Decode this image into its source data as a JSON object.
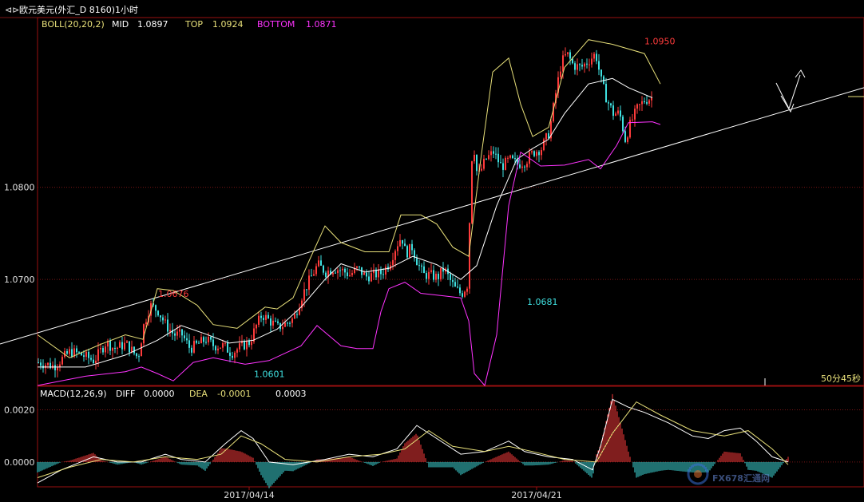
{
  "window": {
    "title": "欧元美元(外汇_D 8160)1小时",
    "countdown": "50分45秒",
    "watermark": "FX678汇通网"
  },
  "colors": {
    "up": "#ff3b3b",
    "down": "#3fe0e0",
    "boll_mid": "#ffffff",
    "boll_top": "#e8e07a",
    "boll_bottom": "#ff33ff",
    "grid": "#7a1515",
    "trendline": "#ffffff"
  },
  "boll": {
    "label": "BOLL(20,20,2)",
    "mid_label": "MID",
    "mid": "1.0897",
    "top_label": "TOP",
    "top": "1.0924",
    "bottom_label": "BOTTOM",
    "bottom": "1.0871"
  },
  "macd": {
    "label": "MACD(12,26,9)",
    "diff_label": "DIFF",
    "diff": "0.0000",
    "dea_label": "DEA",
    "dea": "-0.0001",
    "macd": "0.0003"
  },
  "chart_data": [
    {
      "type": "candlestick",
      "title": "",
      "y_ticks": [
        "1.0800",
        "1.0700"
      ],
      "ylim": [
        1.0585,
        1.0984
      ],
      "x_ticks": [
        "2017/04/14",
        "2017/04/21"
      ],
      "annotations": [
        {
          "text": "1.0676",
          "value": 1.0676
        },
        {
          "text": "1.0601",
          "value": 1.0601
        },
        {
          "text": "1.0681",
          "value": 1.0681
        },
        {
          "text": "1.0950",
          "value": 1.095
        }
      ],
      "close_path": [
        [
          0,
          1.061
        ],
        [
          20,
          1.0606
        ],
        [
          40,
          1.0622
        ],
        [
          55,
          1.0618
        ],
        [
          70,
          1.0612
        ],
        [
          85,
          1.0632
        ],
        [
          95,
          1.0625
        ],
        [
          110,
          1.063
        ],
        [
          125,
          1.0615
        ],
        [
          132,
          1.065
        ],
        [
          140,
          1.0672
        ],
        [
          150,
          1.0666
        ],
        [
          160,
          1.065
        ],
        [
          170,
          1.064
        ],
        [
          180,
          1.064
        ],
        [
          190,
          1.0625
        ],
        [
          200,
          1.063
        ],
        [
          210,
          1.0635
        ],
        [
          220,
          1.0628
        ],
        [
          232,
          1.0628
        ],
        [
          242,
          1.062
        ],
        [
          255,
          1.0628
        ],
        [
          265,
          1.0632
        ],
        [
          272,
          1.0648
        ],
        [
          280,
          1.0662
        ],
        [
          290,
          1.0655
        ],
        [
          300,
          1.0648
        ],
        [
          310,
          1.0652
        ],
        [
          320,
          1.0658
        ],
        [
          330,
          1.0682
        ],
        [
          340,
          1.07
        ],
        [
          350,
          1.0716
        ],
        [
          360,
          1.0708
        ],
        [
          370,
          1.0712
        ],
        [
          380,
          1.071
        ],
        [
          390,
          1.0705
        ],
        [
          400,
          1.0712
        ],
        [
          410,
          1.0703
        ],
        [
          420,
          1.0705
        ],
        [
          430,
          1.0707
        ],
        [
          440,
          1.0718
        ],
        [
          448,
          1.0736
        ],
        [
          455,
          1.0747
        ],
        [
          460,
          1.0728
        ],
        [
          468,
          1.0735
        ],
        [
          475,
          1.0718
        ],
        [
          482,
          1.0705
        ],
        [
          490,
          1.0705
        ],
        [
          500,
          1.0702
        ],
        [
          508,
          1.0712
        ],
        [
          515,
          1.07
        ],
        [
          522,
          1.069
        ],
        [
          530,
          1.0684
        ],
        [
          537,
          1.0694
        ],
        [
          544,
          1.0855
        ],
        [
          550,
          1.081
        ],
        [
          560,
          1.083
        ],
        [
          570,
          1.0838
        ],
        [
          580,
          1.0822
        ],
        [
          590,
          1.083
        ],
        [
          600,
          1.0825
        ],
        [
          610,
          1.0828
        ],
        [
          620,
          1.0838
        ],
        [
          630,
          1.0842
        ],
        [
          640,
          1.086
        ],
        [
          648,
          1.0902
        ],
        [
          655,
          1.0935
        ],
        [
          662,
          1.0945
        ],
        [
          670,
          1.0932
        ],
        [
          680,
          1.093
        ],
        [
          690,
          1.0938
        ],
        [
          698,
          1.0945
        ],
        [
          705,
          1.0915
        ],
        [
          712,
          1.0895
        ],
        [
          720,
          1.088
        ],
        [
          728,
          1.088
        ],
        [
          735,
          1.0852
        ],
        [
          742,
          1.087
        ],
        [
          750,
          1.0885
        ],
        [
          760,
          1.0895
        ],
        [
          770,
          1.0897
        ]
      ],
      "boll_top_path": [
        [
          0,
          1.064
        ],
        [
          40,
          1.0615
        ],
        [
          80,
          1.063
        ],
        [
          110,
          1.064
        ],
        [
          132,
          1.0635
        ],
        [
          150,
          1.069
        ],
        [
          170,
          1.0688
        ],
        [
          185,
          1.068
        ],
        [
          200,
          1.0672
        ],
        [
          220,
          1.0651
        ],
        [
          250,
          1.0647
        ],
        [
          270,
          1.066
        ],
        [
          285,
          1.067
        ],
        [
          300,
          1.0668
        ],
        [
          320,
          1.068
        ],
        [
          340,
          1.072
        ],
        [
          360,
          1.0758
        ],
        [
          380,
          1.074
        ],
        [
          410,
          1.073
        ],
        [
          440,
          1.073
        ],
        [
          455,
          1.077
        ],
        [
          480,
          1.077
        ],
        [
          500,
          1.076
        ],
        [
          520,
          1.0735
        ],
        [
          540,
          1.0725
        ],
        [
          555,
          1.083
        ],
        [
          570,
          1.0925
        ],
        [
          590,
          1.094
        ],
        [
          605,
          1.089
        ],
        [
          620,
          1.0855
        ],
        [
          640,
          1.0865
        ],
        [
          660,
          1.093
        ],
        [
          690,
          1.096
        ],
        [
          720,
          1.0955
        ],
        [
          760,
          1.0945
        ],
        [
          780,
          1.0912
        ]
      ],
      "boll_mid_path": [
        [
          0,
          1.0605
        ],
        [
          60,
          1.0605
        ],
        [
          110,
          1.0618
        ],
        [
          150,
          1.0634
        ],
        [
          180,
          1.065
        ],
        [
          210,
          1.0641
        ],
        [
          240,
          1.0631
        ],
        [
          270,
          1.0634
        ],
        [
          300,
          1.0646
        ],
        [
          330,
          1.067
        ],
        [
          360,
          1.07
        ],
        [
          380,
          1.0717
        ],
        [
          410,
          1.0708
        ],
        [
          440,
          1.0712
        ],
        [
          470,
          1.0725
        ],
        [
          500,
          1.0716
        ],
        [
          530,
          1.07
        ],
        [
          550,
          1.0715
        ],
        [
          575,
          1.078
        ],
        [
          600,
          1.083
        ],
        [
          620,
          1.0842
        ],
        [
          640,
          1.0852
        ],
        [
          660,
          1.088
        ],
        [
          690,
          1.0912
        ],
        [
          720,
          1.0918
        ],
        [
          740,
          1.0908
        ],
        [
          770,
          1.0897
        ]
      ],
      "boll_bottom_path": [
        [
          0,
          1.0585
        ],
        [
          60,
          1.0595
        ],
        [
          110,
          1.06
        ],
        [
          130,
          1.0605
        ],
        [
          150,
          1.0598
        ],
        [
          170,
          1.059
        ],
        [
          195,
          1.061
        ],
        [
          220,
          1.0615
        ],
        [
          260,
          1.0608
        ],
        [
          290,
          1.0612
        ],
        [
          310,
          1.062
        ],
        [
          330,
          1.0628
        ],
        [
          350,
          1.065
        ],
        [
          380,
          1.0628
        ],
        [
          400,
          1.0625
        ],
        [
          420,
          1.0625
        ],
        [
          430,
          1.0665
        ],
        [
          440,
          1.069
        ],
        [
          460,
          1.0697
        ],
        [
          480,
          1.0685
        ],
        [
          510,
          1.0682
        ],
        [
          530,
          1.068
        ],
        [
          540,
          1.0655
        ],
        [
          547,
          1.0598
        ],
        [
          560,
          1.0585
        ],
        [
          575,
          1.064
        ],
        [
          590,
          1.078
        ],
        [
          605,
          1.0838
        ],
        [
          630,
          1.0823
        ],
        [
          660,
          1.0824
        ],
        [
          690,
          1.083
        ],
        [
          705,
          1.082
        ],
        [
          725,
          1.0845
        ],
        [
          740,
          1.087
        ],
        [
          770,
          1.0871
        ],
        [
          780,
          1.0868
        ]
      ],
      "trendline": [
        [
          0,
          1.063
        ],
        [
          1082,
          1.0908
        ]
      ]
    },
    {
      "type": "macd",
      "title": "",
      "y_ticks": [
        "0.0020",
        "0.0000"
      ],
      "ylim": [
        -0.00095,
        0.0029
      ],
      "diff_path": [
        [
          0,
          -0.0008
        ],
        [
          30,
          -0.0003
        ],
        [
          70,
          0.0002
        ],
        [
          100,
          0.0
        ],
        [
          130,
          0.0
        ],
        [
          160,
          0.0003
        ],
        [
          180,
          0.0001
        ],
        [
          210,
          0.0
        ],
        [
          235,
          0.0007
        ],
        [
          255,
          0.0012
        ],
        [
          270,
          0.0009
        ],
        [
          290,
          0.0
        ],
        [
          320,
          -0.0001
        ],
        [
          360,
          0.0001
        ],
        [
          390,
          0.0003
        ],
        [
          420,
          0.0002
        ],
        [
          450,
          0.0005
        ],
        [
          475,
          0.0014
        ],
        [
          500,
          0.0009
        ],
        [
          530,
          0.0003
        ],
        [
          560,
          0.0004
        ],
        [
          590,
          0.0008
        ],
        [
          610,
          0.0004
        ],
        [
          640,
          0.0002
        ],
        [
          670,
          0.0001
        ],
        [
          695,
          -0.0003
        ],
        [
          705,
          0.0006
        ],
        [
          720,
          0.0024
        ],
        [
          740,
          0.0021
        ],
        [
          760,
          0.0019
        ],
        [
          790,
          0.0015
        ],
        [
          820,
          0.001
        ],
        [
          840,
          0.0009
        ],
        [
          860,
          0.0012
        ],
        [
          880,
          0.0013
        ],
        [
          900,
          0.0008
        ],
        [
          920,
          0.0002
        ],
        [
          940,
          0.0
        ]
      ],
      "dea_path": [
        [
          0,
          -0.0006
        ],
        [
          40,
          -0.0002
        ],
        [
          80,
          0.0001
        ],
        [
          120,
          0.0
        ],
        [
          160,
          0.0002
        ],
        [
          200,
          0.0001
        ],
        [
          230,
          0.0003
        ],
        [
          255,
          0.001
        ],
        [
          280,
          0.0007
        ],
        [
          310,
          0.0001
        ],
        [
          350,
          0.0
        ],
        [
          390,
          0.0002
        ],
        [
          430,
          0.0003
        ],
        [
          460,
          0.0005
        ],
        [
          490,
          0.0012
        ],
        [
          520,
          0.0006
        ],
        [
          560,
          0.0004
        ],
        [
          590,
          0.0006
        ],
        [
          620,
          0.0004
        ],
        [
          660,
          0.0001
        ],
        [
          700,
          0.0
        ],
        [
          720,
          0.0011
        ],
        [
          750,
          0.0023
        ],
        [
          780,
          0.0018
        ],
        [
          820,
          0.0012
        ],
        [
          860,
          0.001
        ],
        [
          890,
          0.0012
        ],
        [
          920,
          0.0005
        ],
        [
          940,
          -0.0001
        ]
      ]
    }
  ]
}
